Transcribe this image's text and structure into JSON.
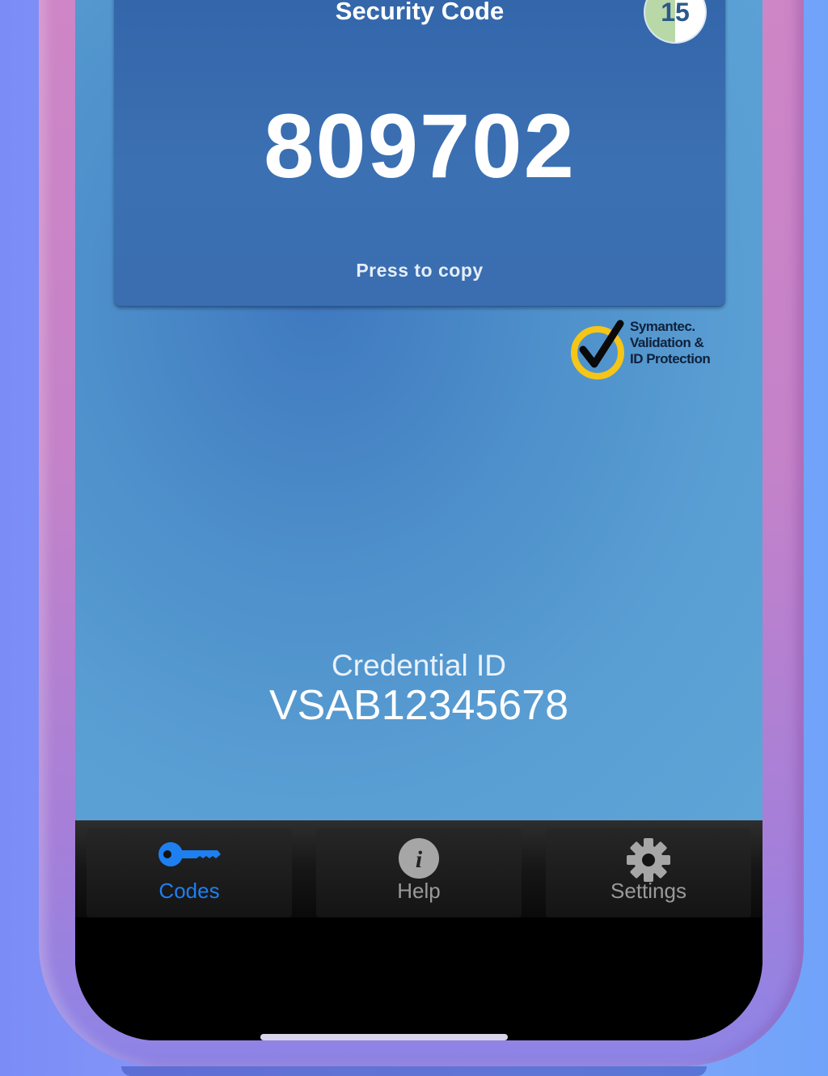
{
  "card": {
    "title": "Security Code",
    "code": "809702",
    "timer_seconds": "15",
    "copy_hint": "Press to copy"
  },
  "badge": {
    "line1": "Symantec.",
    "line2": "Validation &",
    "line3": "ID Protection"
  },
  "credential": {
    "label": "Credential ID",
    "value": "VSAB12345678"
  },
  "tabs": [
    {
      "label": "Codes",
      "icon": "key-icon",
      "active": true
    },
    {
      "label": "Help",
      "icon": "info-icon",
      "active": false
    },
    {
      "label": "Settings",
      "icon": "gear-icon",
      "active": false
    }
  ],
  "colors": {
    "active_tab": "#1e7ff0",
    "inactive_tab": "#9a9a9a",
    "badge_ring": "#f5c518"
  }
}
